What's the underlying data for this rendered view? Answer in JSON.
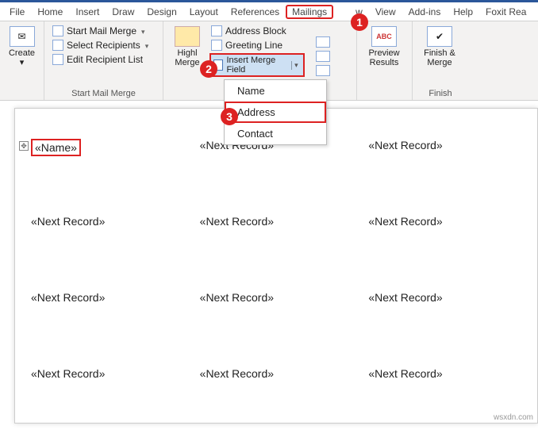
{
  "menu": {
    "items": [
      "File",
      "Home",
      "Insert",
      "Draw",
      "Design",
      "Layout",
      "References",
      "Mailings",
      "Review",
      "View",
      "Add-ins",
      "Help",
      "Foxit Rea"
    ],
    "active_index": 7
  },
  "badges": {
    "b1": "1",
    "b2": "2",
    "b3": "3"
  },
  "ribbon": {
    "create": {
      "label": "Create"
    },
    "start_group": {
      "start_mail_merge": "Start Mail Merge",
      "select_recipients": "Select Recipients",
      "edit_recipient_list": "Edit Recipient List",
      "label": "Start Mail Merge"
    },
    "write_group": {
      "highlight": "Highl\nMerge",
      "address_block": "Address Block",
      "greeting_line": "Greeting Line",
      "insert_merge_field": "Insert Merge Field"
    },
    "preview_group": {
      "preview_results": "Preview\nResults"
    },
    "finish_group": {
      "finish_merge": "Finish &\nMerge",
      "label": "Finish"
    }
  },
  "dropdown": {
    "items": [
      "Name",
      "Address",
      "Contact"
    ],
    "selected_index": 1
  },
  "doc": {
    "name_field": "«Name»",
    "next_record": "«Next Record»"
  },
  "watermark": "wsxdn.com"
}
